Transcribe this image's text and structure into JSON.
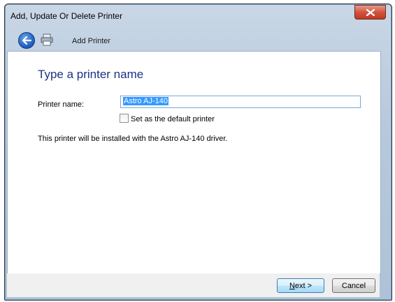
{
  "window": {
    "title": "Add, Update Or Delete Printer"
  },
  "nav": {
    "title": "Add Printer"
  },
  "form": {
    "heading": "Type a printer name",
    "name_label": "Printer name:",
    "name_value": "Astro AJ-140",
    "default_checkbox_label": "Set as the default printer",
    "default_checked": false,
    "info_text": "This printer will be installed with the Astro AJ-140 driver."
  },
  "buttons": {
    "next_underlined": "N",
    "next_rest": "ext >",
    "cancel": "Cancel"
  },
  "icons": {
    "close": "close-icon",
    "back": "back-arrow-icon",
    "printer": "printer-icon"
  }
}
